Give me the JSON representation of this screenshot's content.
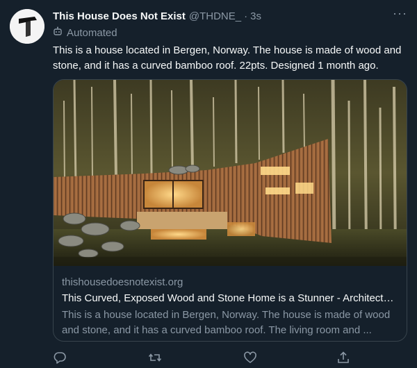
{
  "tweet": {
    "author_name": "This House Does Not Exist",
    "author_handle": "@THDNE_",
    "separator": "·",
    "time": "3s",
    "more_label": "···",
    "automated_label": "Automated",
    "text": "This is a house located in Bergen, Norway. The house is made of wood and stone, and it has a curved bamboo roof. 22pts. Designed 1 month ago."
  },
  "card": {
    "domain": "thishousedoesnotexist.org",
    "title": "This Curved, Exposed Wood and Stone Home is a Stunner - Architect…",
    "description": "This is a house located in Bergen, Norway. The house is made of wood and stone, and it has a curved bamboo roof. The living room and ..."
  },
  "actions": [
    "reply-icon",
    "retweet-icon",
    "like-icon",
    "share-icon"
  ],
  "colors": {
    "background": "#15202b",
    "primary_text": "#f7f9f9",
    "secondary_text": "#8b98a5",
    "border": "#38444d"
  }
}
